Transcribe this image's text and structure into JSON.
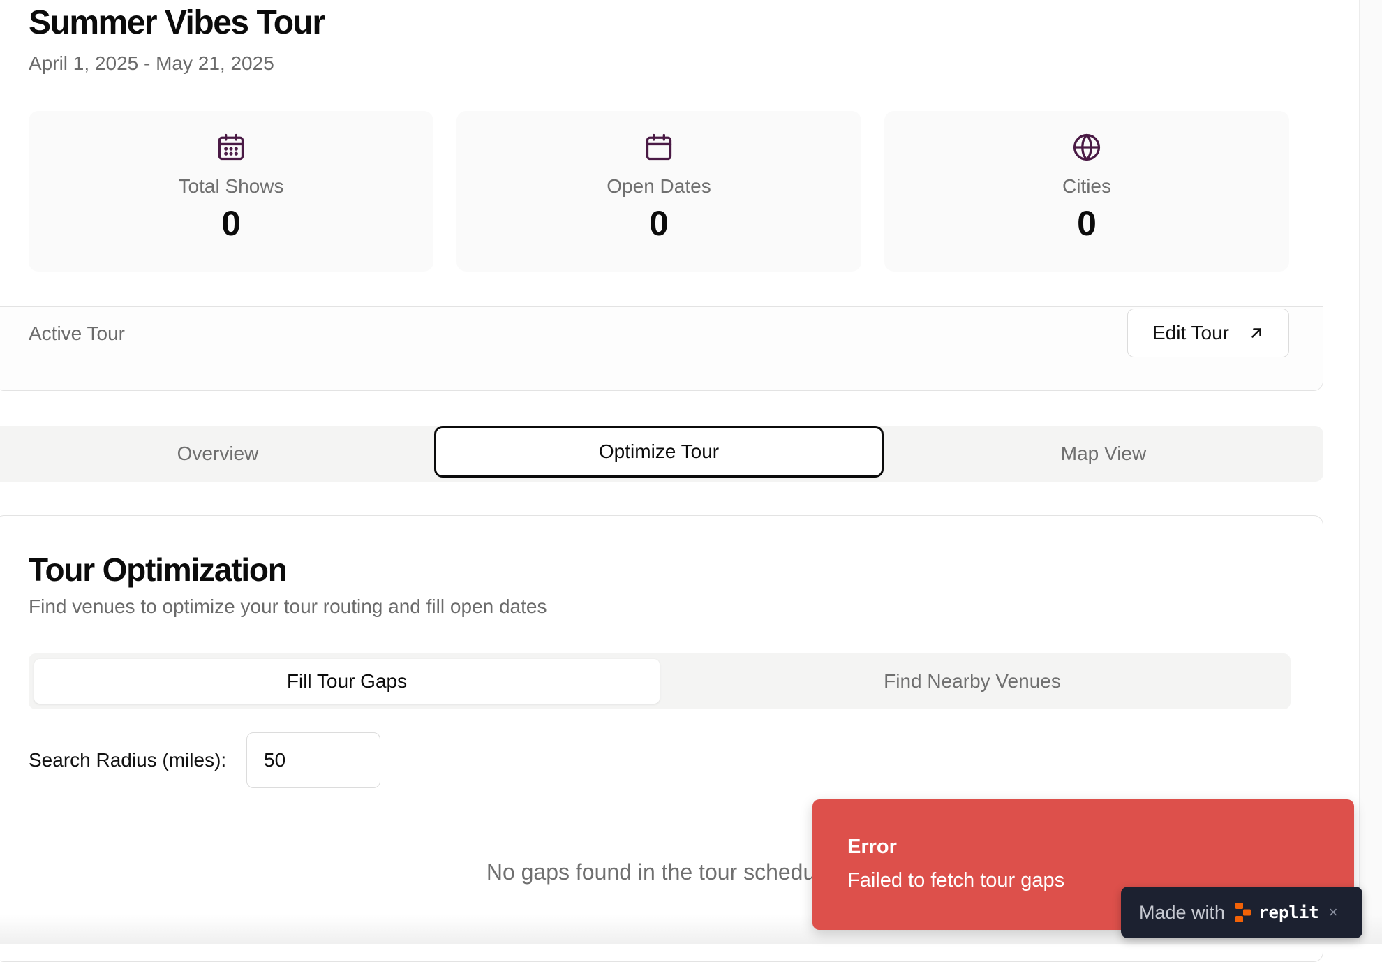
{
  "tour": {
    "title": "Summer Vibes Tour",
    "dates": "April 1, 2025 - May 21, 2025",
    "status": "Active Tour",
    "edit_label": "Edit Tour"
  },
  "stats": [
    {
      "label": "Total Shows",
      "value": "0",
      "icon": "calendar-grid-icon"
    },
    {
      "label": "Open Dates",
      "value": "0",
      "icon": "calendar-icon"
    },
    {
      "label": "Cities",
      "value": "0",
      "icon": "globe-icon"
    }
  ],
  "tabs": [
    {
      "label": "Overview",
      "active": false
    },
    {
      "label": "Optimize Tour",
      "active": true
    },
    {
      "label": "Map View",
      "active": false
    }
  ],
  "optimization": {
    "title": "Tour Optimization",
    "subtitle": "Find venues to optimize your tour routing and fill open dates",
    "subtabs": [
      {
        "label": "Fill Tour Gaps",
        "active": true
      },
      {
        "label": "Find Nearby Venues",
        "active": false
      }
    ],
    "radius_label": "Search Radius (miles):",
    "radius_value": "50",
    "empty_message": "No gaps found in the tour schedule"
  },
  "toast": {
    "title": "Error",
    "description": "Failed to fetch tour gaps"
  },
  "badge": {
    "made_with": "Made with",
    "brand": "replit",
    "close": "×"
  },
  "colors": {
    "icon_accent": "#4a1a45",
    "toast_bg": "#dd504b",
    "badge_bg": "#1c2130",
    "replit_orange": "#f26207"
  }
}
